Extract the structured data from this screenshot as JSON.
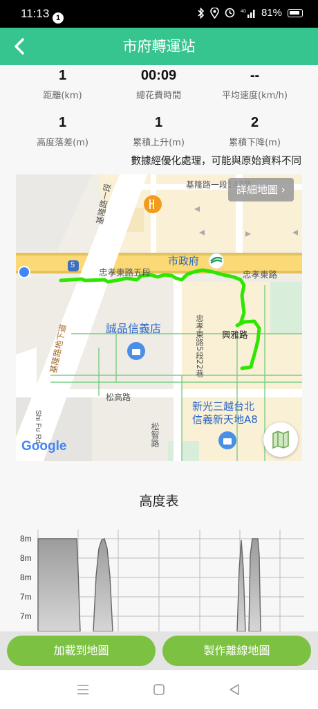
{
  "status_bar": {
    "time": "11:13",
    "notification_count": "1",
    "battery": "81%"
  },
  "header": {
    "title": "市府轉運站"
  },
  "stats": [
    {
      "value": "1",
      "label": "距離(km)"
    },
    {
      "value": "00:09",
      "label": "總花費時間"
    },
    {
      "value": "--",
      "label": "平均速度(km/h)"
    },
    {
      "value": "1",
      "label": "高度落差(m)"
    },
    {
      "value": "1",
      "label": "累積上升(m)"
    },
    {
      "value": "2",
      "label": "累積下降(m)"
    }
  ],
  "note": "數據經優化處理，可能與原始資料不同",
  "map": {
    "detail_button": "詳細地圖 ›",
    "labels": {
      "keelung_rd_sec1": "基隆路一段147巷",
      "keelung_rd_1": "基隆路一段",
      "keelung_rd_underpass": "基隆路地下道",
      "route_5": "5",
      "zhongxiao_e_rd_5": "忠孝東路五段",
      "city_hall": "市政府",
      "zhongxiao_e_rd": "忠孝東路",
      "eslite": "誠品信義店",
      "zhongxiao_lane22": "忠孝東路5段22巷",
      "xingya_rd": "興雅路",
      "songgao_rd": "松高路",
      "shin_kong": "新光三越台北",
      "a8": "信義新天地A8",
      "shifu_rd": "Shi Fu Rd",
      "songzhi_rd": "松智路",
      "google": "Google"
    }
  },
  "elevation": {
    "title": "高度表",
    "y_labels": [
      "8m",
      "8m",
      "8m",
      "7m",
      "7m"
    ]
  },
  "buttons": {
    "load_to_map": "加載到地圖",
    "offline_map": "製作離線地圖"
  },
  "colors": {
    "header": "#36c48f",
    "route": "#2ee600",
    "button": "#7cc142"
  }
}
